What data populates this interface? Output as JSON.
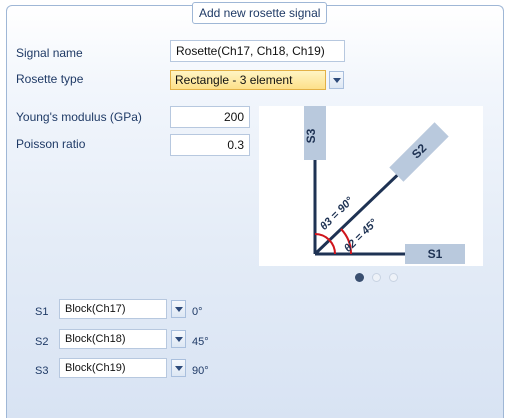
{
  "dialog": {
    "title": "Add new rosette signal"
  },
  "form": {
    "signal_name": {
      "label": "Signal name",
      "value": "Rosette(Ch17, Ch18, Ch19)"
    },
    "rosette_type": {
      "label": "Rosette type",
      "value": "Rectangle - 3 element"
    },
    "youngs_modulus": {
      "label": "Young's modulus (GPa)",
      "value": "200"
    },
    "poisson_ratio": {
      "label": "Poisson ratio",
      "value": "0.3"
    }
  },
  "diagram": {
    "gauges": {
      "s1": "S1",
      "s2": "S2",
      "s3": "S3"
    },
    "angle_theta2": "θ2 = 45°",
    "angle_theta3": "θ3 = 90°",
    "colors": {
      "gauge_fill": "#b9c9dd",
      "axis": "#1e3253",
      "arc": "#d0151c"
    }
  },
  "pager": {
    "total": 3,
    "active": 1
  },
  "channels": [
    {
      "label": "S1",
      "value": "Block(Ch17)",
      "angle": "0°"
    },
    {
      "label": "S2",
      "value": "Block(Ch18)",
      "angle": "45°"
    },
    {
      "label": "S3",
      "value": "Block(Ch19)",
      "angle": "90°"
    }
  ]
}
